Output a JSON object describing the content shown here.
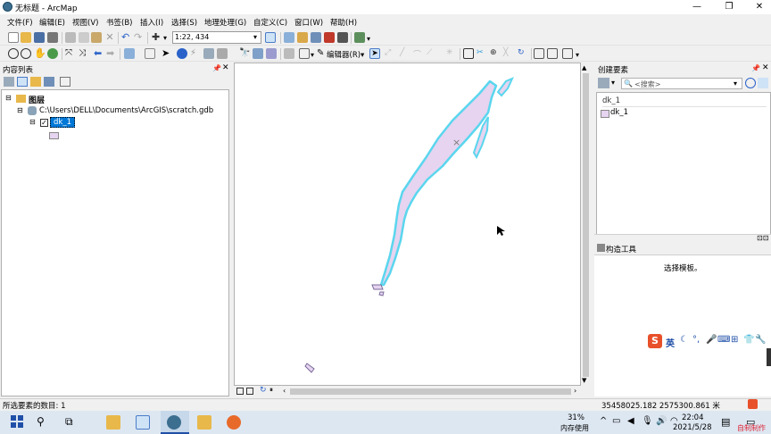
{
  "window": {
    "title": "无标题 - ArcMap",
    "controls": [
      "—",
      "❐",
      "✕"
    ]
  },
  "menu": [
    "文件(F)",
    "编辑(E)",
    "视图(V)",
    "书签(B)",
    "插入(I)",
    "选择(S)",
    "地理处理(G)",
    "自定义(C)",
    "窗口(W)",
    "帮助(H)"
  ],
  "toolbar": {
    "scale": "1:22, 434",
    "editor_label": "编辑器(R)▾"
  },
  "toc": {
    "title": "内容列表",
    "layers_label": "图层",
    "gdb_path": "C:\\Users\\DELL\\Documents\\ArcGIS\\scratch.gdb",
    "layer_name": "dk_1"
  },
  "create_features": {
    "title": "创建要素",
    "search_placeholder": "<搜索>",
    "group_label": "dk_1",
    "item_label": "dk_1"
  },
  "construct_tools": {
    "title": "构造工具",
    "hint": "选择模板。"
  },
  "ime": {
    "lang": "英"
  },
  "status": {
    "selected": "所选要素的数目: 1",
    "coords": "35458025.182  2575300.861 米"
  },
  "taskbar": {
    "memory_pct": "31%",
    "memory_label": "内存使用",
    "time": "22:04",
    "date": "2021/5/28",
    "watermark": "自制制作"
  },
  "colors": {
    "polygon_fill": "#e6d4f0",
    "polygon_outline": "#5ad6ee",
    "selection": "#00e5ff"
  }
}
